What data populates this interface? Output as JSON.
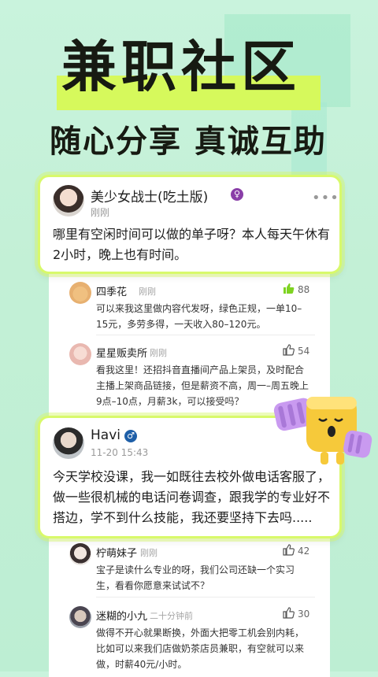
{
  "hero": {
    "title": "兼职社区",
    "subtitle": "随心分享 真诚互助"
  },
  "posts": [
    {
      "author": "美少女战士(吃土版)",
      "gender": "female",
      "gender_symbol": "♀",
      "time": "刚刚",
      "content": "哪里有空闲时间可以做的单子呀？本人每天午休有2小时，晚上也有时间。",
      "comments": [
        {
          "author": "四季花",
          "time": "刚刚",
          "likes": "88",
          "liked": true,
          "content": "可以来我这里做内容代发呀，绿色正规，一单10–15元，多劳多得，一天收入80–120元。"
        },
        {
          "author": "星星贩卖所",
          "time": "刚刚",
          "likes": "54",
          "liked": false,
          "content": "看我这里！还招抖音直播间产品上架员，及时配合主播上架商品链接，但是薪资不高，周一–周五晚上9点–10点，月薪3k，可以接受吗？"
        }
      ]
    },
    {
      "author": "Havi",
      "gender": "male",
      "gender_symbol": "♂",
      "time": "11-20 15:43",
      "content": "今天学校没课，我一如既往去校外做电话客服了，做一些很机械的电话问卷调查，跟我学的专业好不搭边，学不到什么技能，我还要坚持下去吗.....",
      "comments": [
        {
          "author": "柠萌妹子",
          "time": "刚刚",
          "likes": "42",
          "liked": false,
          "content": "宝子是读什么专业的呀，我们公司还缺一个实习生，看看你愿意来试试不？"
        },
        {
          "author": "迷糊的小九",
          "time": "二十分钟前",
          "likes": "30",
          "liked": false,
          "content": "做得不开心就果断换，外面大把零工机会别内耗，比如可以来我们店做奶茶店员兼职，有空就可以来做，时薪40元/小时。"
        }
      ]
    }
  ],
  "colors": {
    "accent": "#d6f95c",
    "like_active": "#7ed321",
    "female": "#8a3ea8",
    "male": "#1e5fa8"
  },
  "icons": {
    "more": "more-dots-icon",
    "like": "thumbs-up-icon"
  }
}
